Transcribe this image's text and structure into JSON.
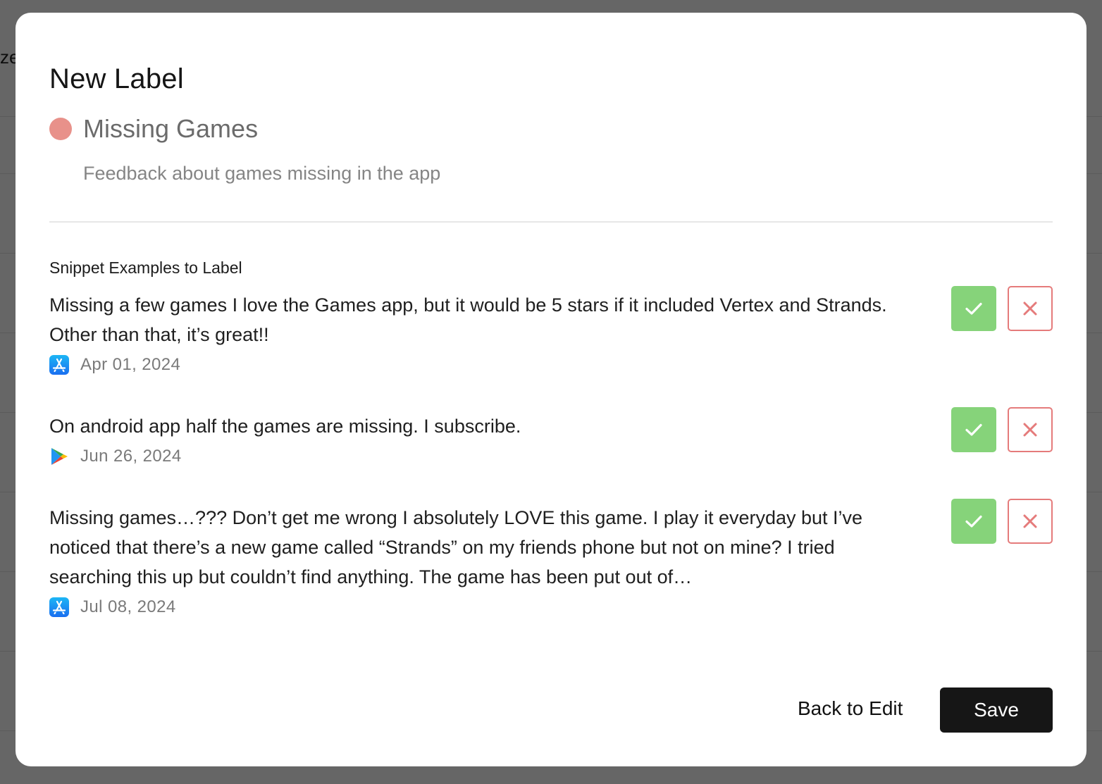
{
  "background": {
    "peek_text": "ze"
  },
  "modal": {
    "title": "New Label",
    "label": {
      "name": "Missing Games",
      "description": "Feedback about games missing in the app",
      "color": "#e8918a"
    },
    "section_title": "Snippet Examples to Label",
    "snippets": [
      {
        "text": "Missing a few games I love the Games app, but it would be 5 stars if it included Vertex and Strands. Other than that, it’s great!!",
        "source_icon": "app-store-icon",
        "date": "Apr 01, 2024"
      },
      {
        "text": "On android app half the games are missing. I subscribe.",
        "source_icon": "google-play-icon",
        "date": "Jun 26, 2024"
      },
      {
        "text": "Missing games…??? Don’t get me wrong I absolutely LOVE this game. I play it everyday but I’ve noticed that there’s a new game called “Strands” on my friends phone but not on mine? I tried searching this up but couldn’t find anything. The game has been put out of…",
        "source_icon": "app-store-icon",
        "date": "Jul 08, 2024"
      }
    ],
    "accept_icon": "checkmark-icon",
    "reject_icon": "x-icon",
    "back_label": "Back to Edit",
    "save_label": "Save",
    "colors": {
      "accept": "#86d37a",
      "reject": "#e57b7b",
      "save": "#161616"
    }
  }
}
